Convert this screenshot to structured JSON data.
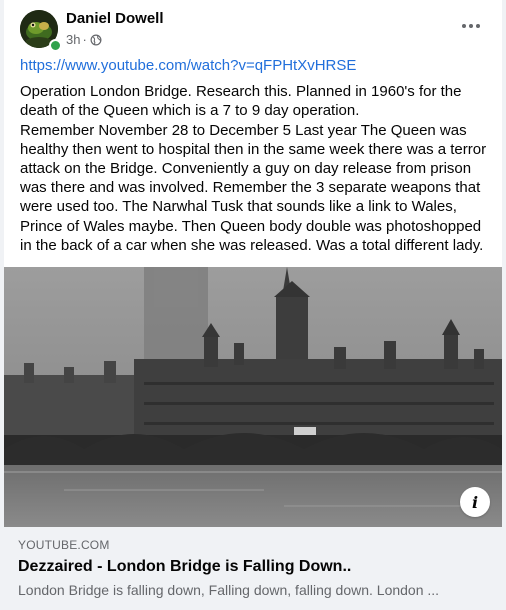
{
  "post": {
    "author": "Daniel Dowell",
    "time": "3h",
    "separator": "·",
    "privacy_icon": "globe-icon",
    "link_url": "https://www.youtube.com/watch?v=qFPHtXvHRSE",
    "text": "Operation London Bridge. Research this. Planned in 1960's for the death of the Queen which is a 7 to 9 day operation.\nRemember November 28 to December 5 Last year The Queen was healthy then went to hospital then in the same week there was a terror attack on the Bridge. Conveniently a guy on day release from prison was there and was involved.  Remember the 3 separate weapons that were used too. The Narwhal Tusk that sounds like a link to Wales, Prince of Wales maybe. Then Queen body double was photoshopped in the back of a car when she was released. Was a total different lady."
  },
  "link_preview": {
    "domain": "YOUTUBE.COM",
    "title": "Dezzaired - London Bridge is Falling Down..",
    "description": "London Bridge is falling down, Falling down, falling down. London ...",
    "info_glyph": "i"
  },
  "colors": {
    "link": "#216fdb",
    "secondary_text": "#65676b",
    "online": "#31a24c",
    "preview_bg": "#f0f2f5"
  }
}
